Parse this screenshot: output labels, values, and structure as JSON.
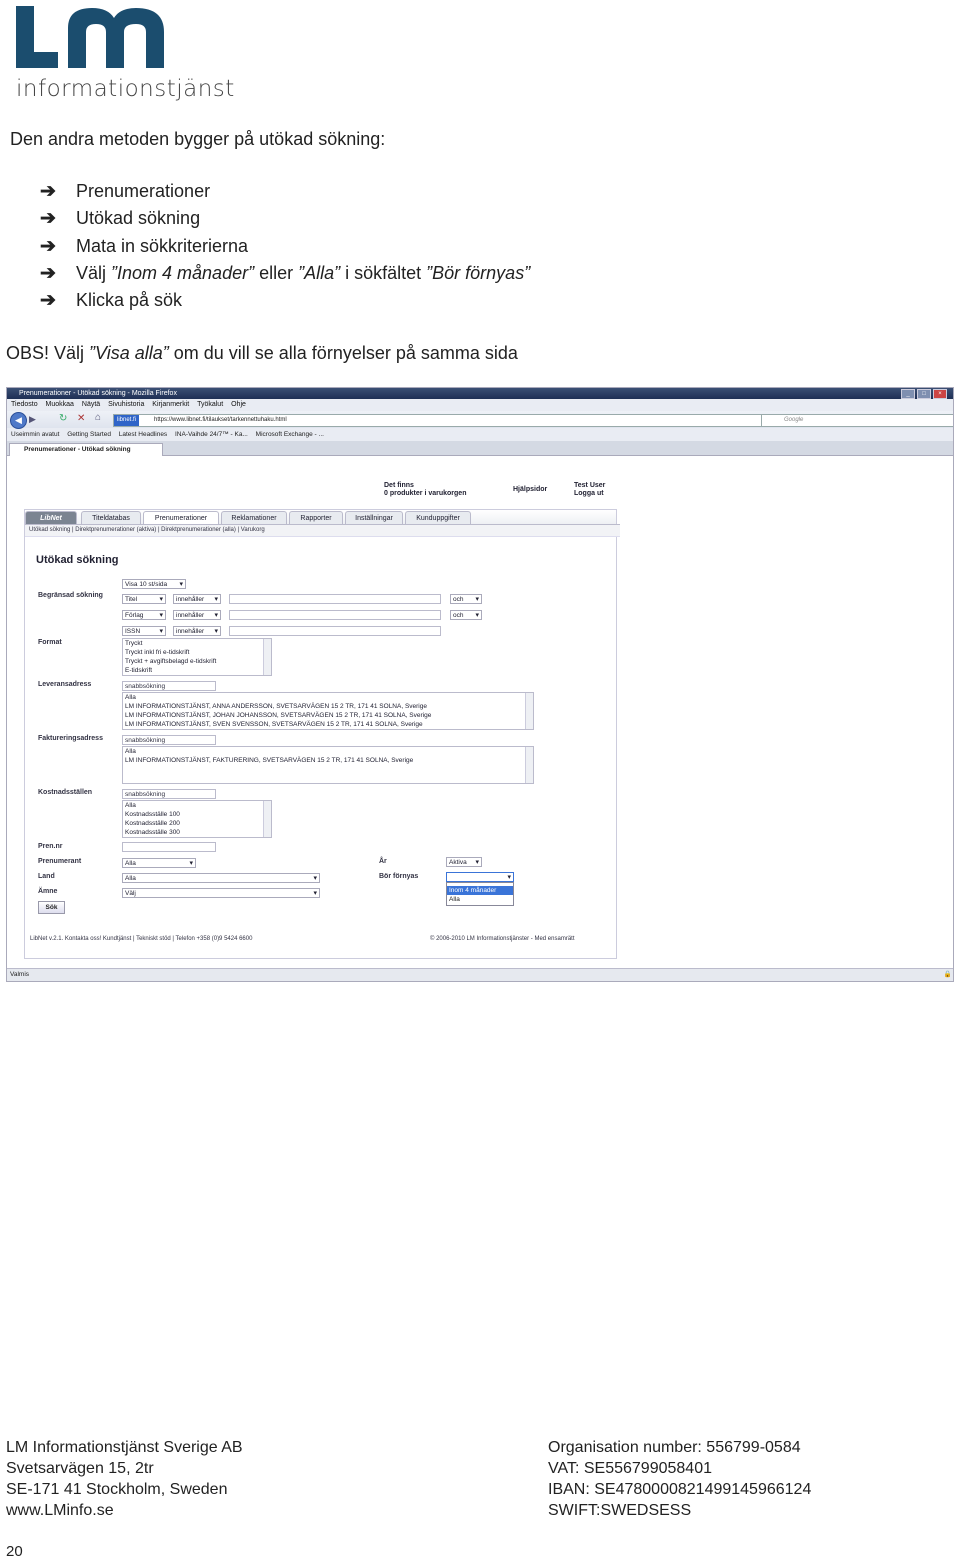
{
  "logo": {
    "text": "informationstjänst"
  },
  "intro": "Den andra metoden bygger på utökad sökning:",
  "steps": {
    "s1": "Prenumerationer",
    "s2": "Utökad sökning",
    "s3": "Mata in sökkriterierna",
    "s4": {
      "a": "Välj ",
      "b": "”Inom 4 månader”",
      "c": " eller ",
      "d": "”Alla”",
      "e": " i sökfältet ",
      "f": "”Bör förnyas”"
    },
    "s5": "Klicka på sök"
  },
  "obs": {
    "a": "OBS!",
    "b": " Välj ",
    "c": "”Visa alla”",
    "d": " om du vill se alla förnyelser på samma sida"
  },
  "browser": {
    "title": "Prenumerationer - Utökad sökning - Mozilla Firefox",
    "menu": [
      "Tiedosto",
      "Muokkaa",
      "Näytä",
      "Sivuhistoria",
      "Kirjanmerkit",
      "Työkalut",
      "Ohje"
    ],
    "site": "libnet.fi",
    "url": "https://www.libnet.fi/tilaukset/tarkennettuhaku.html",
    "search_placeholder": "Google",
    "bookmarks": [
      "Useimmin avatut",
      "Getting Started",
      "Latest Headlines",
      "INA-Vaihde 24/7™ - Ka...",
      "Microsoft Exchange - ..."
    ],
    "tab": "Prenumerationer - Utökad sökning",
    "status": "Valmis"
  },
  "libnet": {
    "cart": {
      "l1": "Det finns",
      "l2": "0 produkter i varukorgen"
    },
    "help": "Hjälpsidor",
    "user": {
      "l1": "Test User",
      "l2": "Logga ut"
    },
    "tabs": [
      "LibNet",
      "Titeldatabas",
      "Prenumerationer",
      "Reklamationer",
      "Rapporter",
      "Inställningar",
      "Kunduppgifter"
    ],
    "subtabs": "Utökad sökning | Direktprenumerationer (aktiva) | Direktprenumerationer (alla) | Varukorg",
    "heading": "Utökad sökning",
    "visa": "Visa 10 st/sida",
    "labels": {
      "begransad": "Begränsad sökning",
      "format": "Format",
      "leverans": "Leveransadress",
      "fakt": "Faktureringsadress",
      "kostnad": "Kostnadsställen",
      "prennr": "Pren.nr",
      "prenumerant": "Prenumerant",
      "land": "Land",
      "amne": "Ämne",
      "ar": "År",
      "bor": "Bör förnyas"
    },
    "rows": [
      {
        "field": "Titel",
        "op": "innehåller",
        "conj": "och"
      },
      {
        "field": "Förlag",
        "op": "innehåller",
        "conj": "och"
      },
      {
        "field": "ISSN",
        "op": "innehåller",
        "conj": ""
      }
    ],
    "format_opts": [
      "Tryckt",
      "Tryckt inkl fri e-tidskrift",
      "Tryckt + avgiftsbelagd e-tidskrift",
      "E-tidskrift"
    ],
    "quick": "snabbsökning",
    "leverans_opts": [
      "Alla",
      "LM INFORMATIONSTJÄNST, ANNA ANDERSSON, SVETSARVÄGEN 15 2 TR, 171 41 SOLNA, Sverige",
      "LM INFORMATIONSTJÄNST, JOHAN JOHANSSON, SVETSARVÄGEN 15 2 TR, 171 41 SOLNA, Sverige",
      "LM INFORMATIONSTJÄNST, SVEN SVENSSON, SVETSARVÄGEN 15 2 TR, 171 41 SOLNA, Sverige"
    ],
    "fakt_opts": [
      "Alla",
      "LM INFORMATIONSTJÄNST, FAKTURERING, SVETSARVÄGEN 15 2 TR, 171 41 SOLNA, Sverige"
    ],
    "kostnad_opts": [
      "Alla",
      "Kostnadsställe 100",
      "Kostnadsställe 200",
      "Kostnadsställe 300"
    ],
    "prenumerant_val": "Alla",
    "land_val": "Alla",
    "amne_val": "Välj",
    "ar_val": "Aktiva",
    "bor_opts": [
      "Inom 4 månader",
      "Alla"
    ],
    "sok": "Sök",
    "footer_left": "LibNet v.2.1. Kontakta oss! Kundtjänst | Tekniskt stöd | Telefon +358 (0)9 5424 6600",
    "footer_right": "© 2006-2010 LM Informationstjänster - Med ensamrätt"
  },
  "footer": {
    "company": "LM Informationstjänst Sverige AB",
    "street": "Svetsarvägen 15, 2tr",
    "city": "SE-171 41 Stockholm, Sweden",
    "web": "www.LMinfo.se",
    "org": "Organisation number: 556799-0584",
    "vat": "VAT: SE556799058401",
    "iban": "IBAN: SE4780000821499145966124",
    "swift": "SWIFT:SWEDSESS"
  },
  "page_number": "20",
  "colors": {
    "logo": "#1b4d6e",
    "tab_active": "#ffffff",
    "highlight": "#3a74d8"
  }
}
